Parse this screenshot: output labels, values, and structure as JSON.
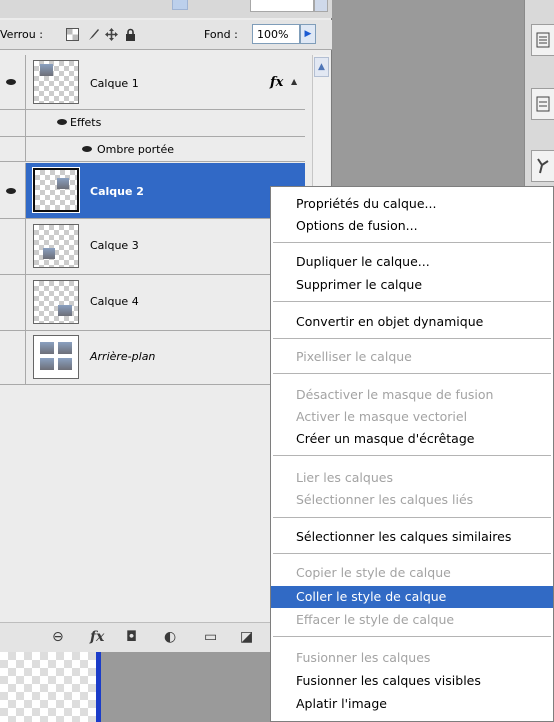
{
  "lock_row": {
    "lock_label": "Verrou :",
    "fill_label": "Fond :",
    "fill_value": "100%"
  },
  "layers": {
    "calque1": "Calque 1",
    "fx": "fx",
    "effets": "Effets",
    "ombre": "Ombre portée",
    "calque2": "Calque 2",
    "calque3": "Calque 3",
    "calque4": "Calque 4",
    "arriere": "Arrière-plan"
  },
  "bottom_bar": {
    "link": "⊖",
    "fx": "fx",
    "mask": "◘",
    "adjust": "◐",
    "group": "▭",
    "new": "◪"
  },
  "menu": {
    "items": [
      {
        "label": "Propriétés du calque...",
        "state": "enabled"
      },
      {
        "label": "Options de fusion...",
        "state": "enabled"
      },
      {
        "label": "Dupliquer le calque...",
        "state": "enabled"
      },
      {
        "label": "Supprimer le calque",
        "state": "enabled"
      },
      {
        "label": "Convertir en objet dynamique",
        "state": "enabled"
      },
      {
        "label": "Pixelliser le calque",
        "state": "disabled"
      },
      {
        "label": "Désactiver le masque de fusion",
        "state": "disabled"
      },
      {
        "label": "Activer le masque vectoriel",
        "state": "disabled"
      },
      {
        "label": "Créer un masque d'écrêtage",
        "state": "enabled"
      },
      {
        "label": "Lier les calques",
        "state": "disabled"
      },
      {
        "label": "Sélectionner les calques liés",
        "state": "disabled"
      },
      {
        "label": "Sélectionner les calques similaires",
        "state": "enabled"
      },
      {
        "label": "Copier le style de calque",
        "state": "disabled"
      },
      {
        "label": "Coller le style de calque",
        "state": "highlighted"
      },
      {
        "label": "Effacer le style de calque",
        "state": "disabled"
      },
      {
        "label": "Fusionner les calques",
        "state": "disabled"
      },
      {
        "label": "Fusionner les calques visibles",
        "state": "enabled"
      },
      {
        "label": "Aplatir l'image",
        "state": "enabled"
      }
    ]
  },
  "colors": {
    "selection": "#3169c6",
    "menu_highlight": "#316ac5",
    "disabled_text": "#a3a3a3"
  }
}
